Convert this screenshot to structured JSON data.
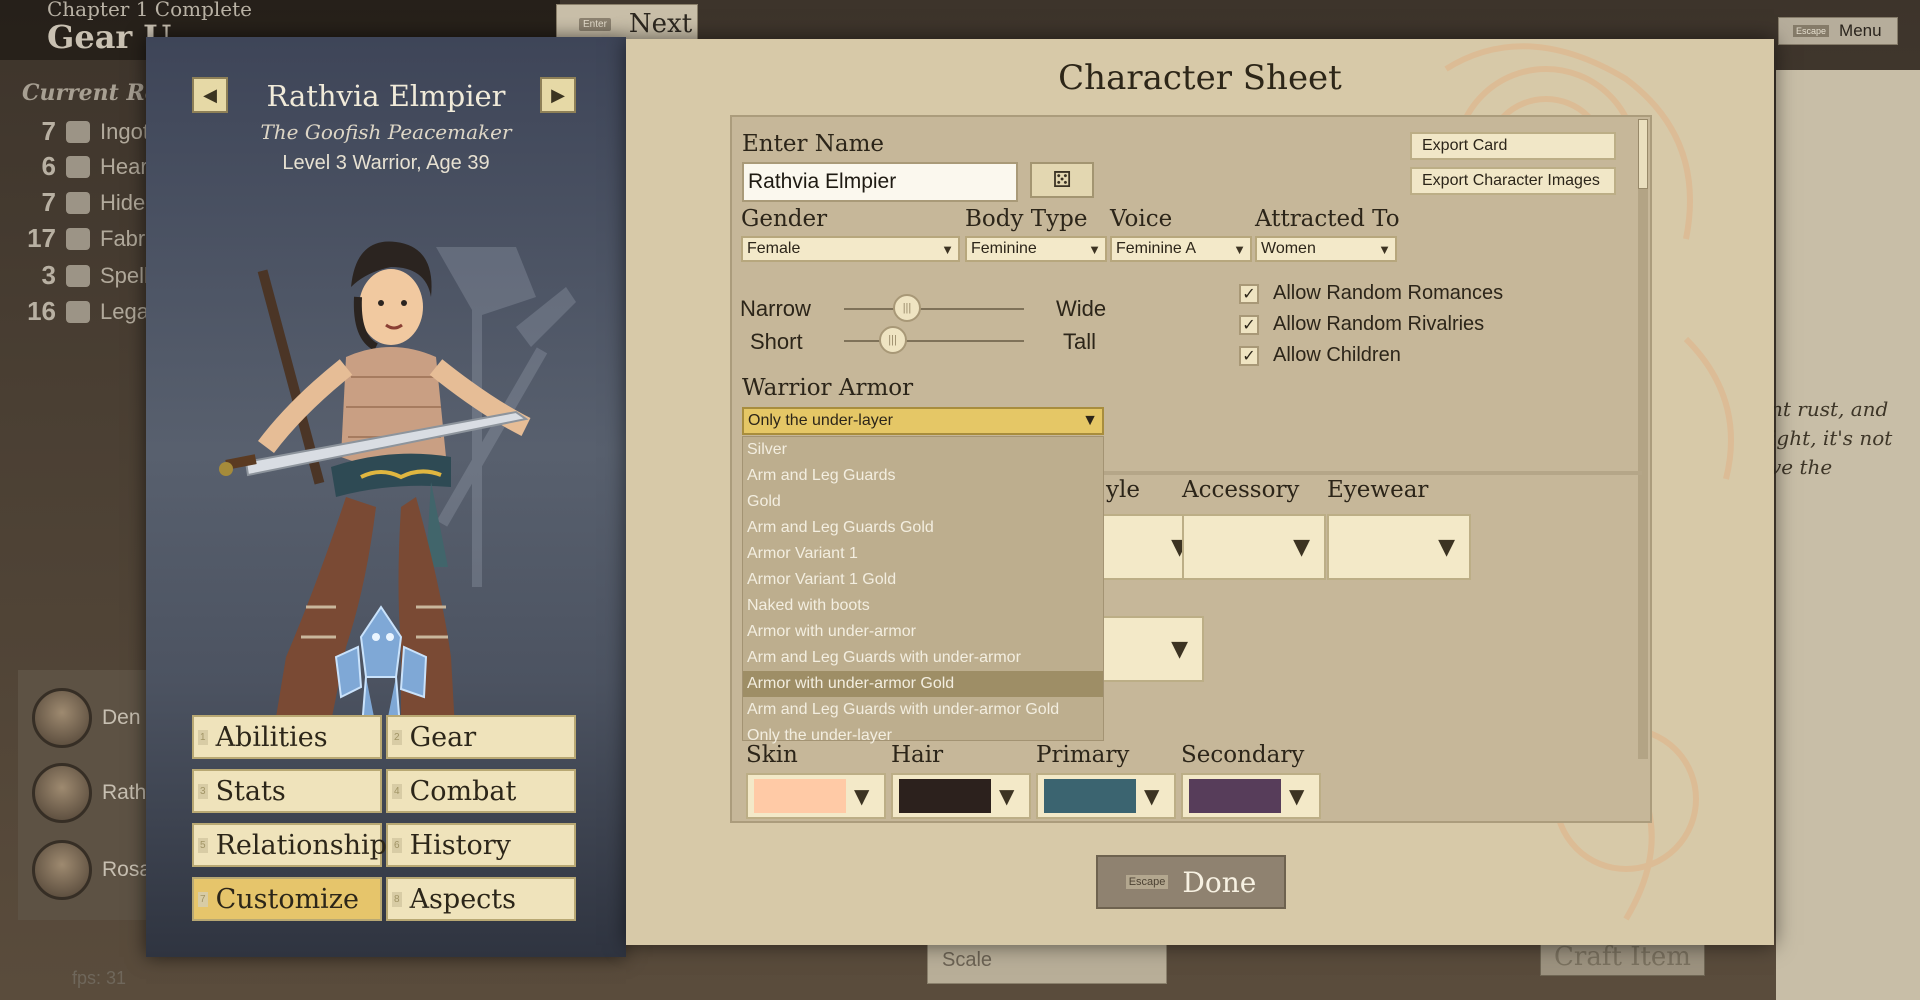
{
  "background": {
    "chapter_text": "Chapter 1 Complete",
    "gear_title": "Gear U",
    "next_key": "Enter",
    "next_label": "Next",
    "menu_key": "Escape",
    "menu_label": "Menu",
    "resources_title": "Current Reso",
    "resources": [
      {
        "count": "7",
        "name": "Ingot"
      },
      {
        "count": "6",
        "name": "Hear"
      },
      {
        "count": "7",
        "name": "Hide"
      },
      {
        "count": "17",
        "name": "Fabri"
      },
      {
        "count": "3",
        "name": "Spell"
      },
      {
        "count": "16",
        "name": "Legac"
      }
    ],
    "roster": [
      {
        "name": "Den"
      },
      {
        "name": "Rath"
      },
      {
        "name": "Rosa"
      }
    ],
    "fps": "fps: 31",
    "right_text": "nt rust, and ight, it's not ve the",
    "scale_label": "Scale",
    "craft_label": "Craft Item"
  },
  "character": {
    "name": "Rathvia Elmpier",
    "title": "The Goofish Peacemaker",
    "level_line": "Level 3 Warrior, Age 39"
  },
  "menu": [
    {
      "key": "1",
      "label": "Abilities",
      "active": false
    },
    {
      "key": "2",
      "label": "Gear",
      "active": false
    },
    {
      "key": "3",
      "label": "Stats",
      "active": false
    },
    {
      "key": "4",
      "label": "Combat",
      "active": false
    },
    {
      "key": "5",
      "label": "Relationships",
      "active": false
    },
    {
      "key": "6",
      "label": "History",
      "active": false
    },
    {
      "key": "7",
      "label": "Customize",
      "active": true
    },
    {
      "key": "8",
      "label": "Aspects",
      "active": false
    }
  ],
  "sheet": {
    "title": "Character Sheet",
    "enter_name_label": "Enter Name",
    "name_value": "Rathvia Elmpier",
    "export_card": "Export Card",
    "export_images": "Export Character Images",
    "gender_label": "Gender",
    "gender_value": "Female",
    "body_label": "Body Type",
    "body_value": "Feminine",
    "voice_label": "Voice",
    "voice_value": "Feminine A",
    "attracted_label": "Attracted To",
    "attracted_value": "Women",
    "narrow_label": "Narrow",
    "wide_label": "Wide",
    "short_label": "Short",
    "tall_label": "Tall",
    "width_slider": 0.35,
    "height_slider": 0.27,
    "checkboxes": [
      {
        "label": "Allow Random Romances",
        "checked": true
      },
      {
        "label": "Allow Random Rivalries",
        "checked": true
      },
      {
        "label": "Allow Children",
        "checked": true
      }
    ],
    "armor_label": "Warrior Armor",
    "armor_value": "Only the under-layer",
    "armor_options": [
      "Silver",
      "Arm and Leg Guards",
      "Gold",
      "Arm and Leg Guards Gold",
      "Armor Variant 1",
      "Armor Variant 1 Gold",
      "Naked with boots",
      "Armor with under-armor",
      "Arm and Leg Guards with under-armor",
      "Armor with under-armor Gold",
      "Arm and Leg Guards with under-armor Gold",
      "Only the under-layer"
    ],
    "armor_highlighted": "Armor with under-armor Gold",
    "style_label": "yle",
    "accessory_label": "Accessory",
    "eyewear_label": "Eyewear",
    "skin_label": "Skin",
    "hair_label": "Hair",
    "primary_label": "Primary",
    "secondary_label": "Secondary",
    "colors": {
      "skin": "#ffcaa6",
      "hair": "#2c211d",
      "primary": "#3b6470",
      "secondary": "#573d5a"
    },
    "done_key": "Escape",
    "done_label": "Done"
  }
}
